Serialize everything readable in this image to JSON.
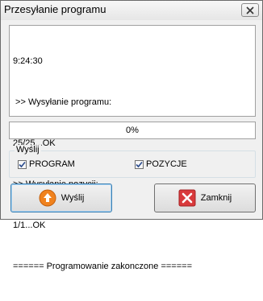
{
  "window": {
    "title": "Przesyłanie programu"
  },
  "log": {
    "lines": [
      "9:24:30",
      " >> Wysyłanie programu:",
      "25/25...OK",
      ">> Wysyłanie pozycji:",
      "1/1...OK",
      "====== Programowanie zakonczone ======"
    ]
  },
  "progress": {
    "text": "0%",
    "value": 0
  },
  "group": {
    "legend": "Wyślij",
    "program_label": "PROGRAM",
    "program_checked": true,
    "positions_label": "POZYCJE",
    "positions_checked": true
  },
  "buttons": {
    "send_label": "Wyślij",
    "close_label": "Zamknij"
  },
  "icons": {
    "send": "upload-arrow-icon",
    "close": "red-x-icon",
    "title_close": "close-icon"
  },
  "colors": {
    "send_icon": "#f0821e",
    "close_icon": "#d9393b",
    "progress": "#06b025"
  }
}
